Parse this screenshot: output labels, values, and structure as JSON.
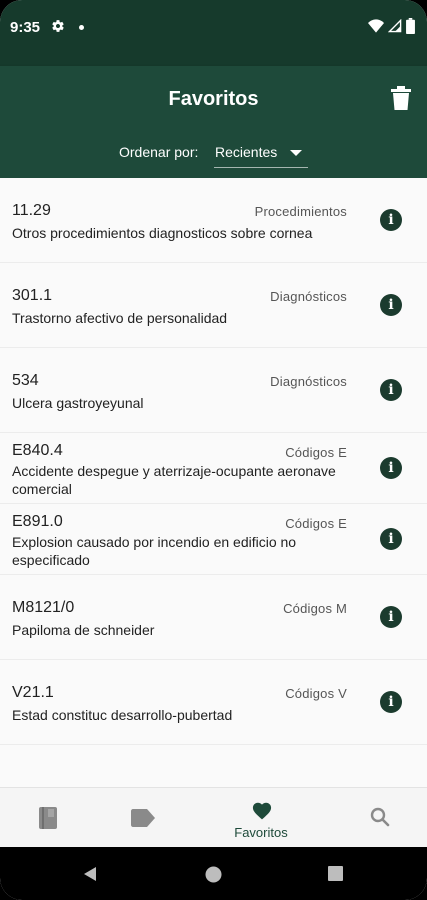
{
  "status_bar": {
    "time": "9:35"
  },
  "app_bar": {
    "title": "Favoritos",
    "sort_label": "Ordenar por:",
    "sort_value": "Recientes"
  },
  "items": [
    {
      "code": "11.29",
      "category": "Procedimientos",
      "description": "Otros procedimientos diagnosticos sobre cornea"
    },
    {
      "code": "301.1",
      "category": "Diagnósticos",
      "description": "Trastorno afectivo de personalidad"
    },
    {
      "code": "534",
      "category": "Diagnósticos",
      "description": "Ulcera gastroyeyunal"
    },
    {
      "code": "E840.4",
      "category": "Códigos E",
      "description": "Accidente despegue y aterrizaje-ocupante aeronave comercial"
    },
    {
      "code": "E891.0",
      "category": "Códigos E",
      "description": "Explosion causado por incendio en edificio no especificado"
    },
    {
      "code": "M8121/0",
      "category": "Códigos M",
      "description": "Papiloma de schneider"
    },
    {
      "code": "V21.1",
      "category": "Códigos V",
      "description": "Estad constituc desarrollo-pubertad"
    }
  ],
  "bottom_nav": {
    "items": [
      {
        "icon": "book-icon",
        "label": ""
      },
      {
        "icon": "label-tag-icon",
        "label": ""
      },
      {
        "icon": "heart-icon",
        "label": "Favoritos"
      },
      {
        "icon": "search-icon",
        "label": ""
      }
    ]
  },
  "colors": {
    "status_bar": "#163a2c",
    "app_bar": "#1e4a3a",
    "accent": "#1b3b2e",
    "background": "#fafafa"
  }
}
